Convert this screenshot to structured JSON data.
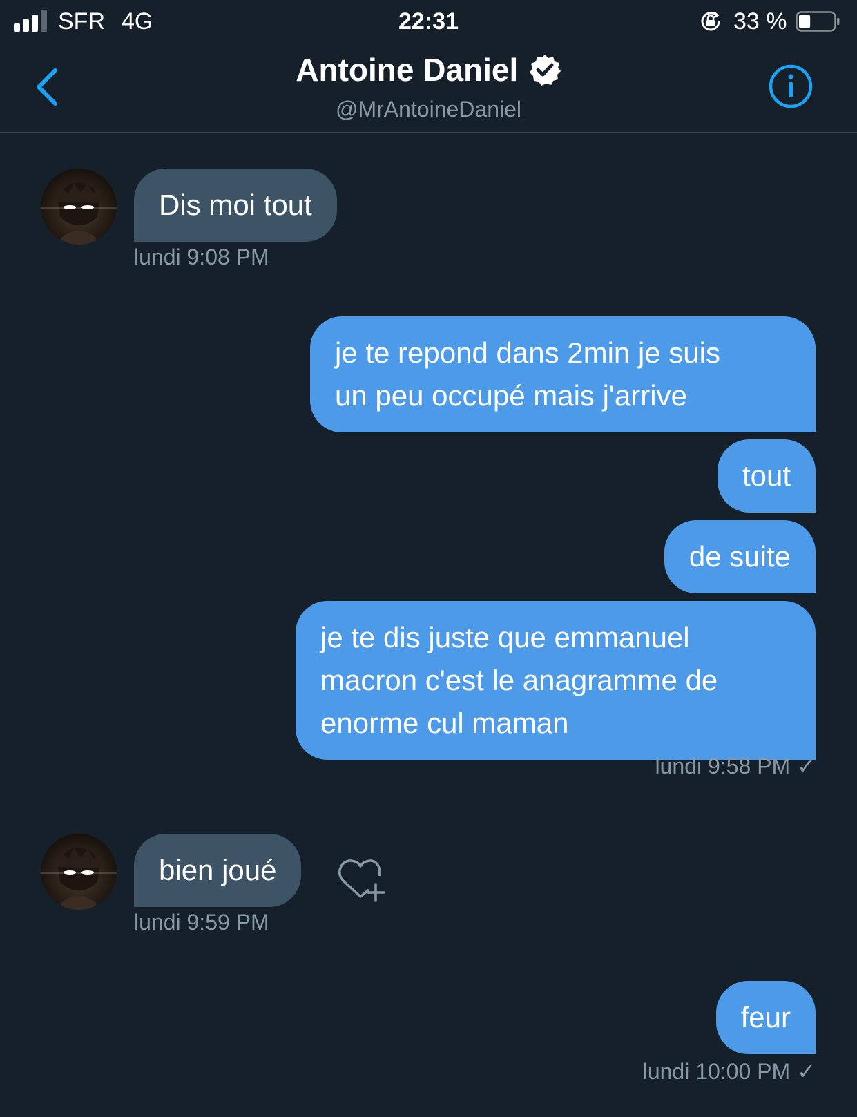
{
  "status_bar": {
    "carrier": "SFR",
    "network": "4G",
    "time": "22:31",
    "battery": "33 %",
    "battery_level": 0.33
  },
  "header": {
    "name": "Antoine Daniel",
    "handle": "@MrAntoineDaniel",
    "verified": true
  },
  "messages": [
    {
      "side": "in",
      "text": "Dis moi tout"
    },
    {
      "side": "in",
      "time": "lundi 9:08 PM"
    },
    {
      "side": "out",
      "lines": [
        "je te repond dans 2min je suis",
        "un peu occupé mais j'arrive"
      ]
    },
    {
      "side": "out",
      "text": "tout"
    },
    {
      "side": "out",
      "text": "de suite"
    },
    {
      "side": "out",
      "lines": [
        "je te dis juste que emmanuel",
        "macron c'est le anagramme de",
        "enorme cul maman"
      ]
    },
    {
      "side": "out",
      "time": "lundi 9:58 PM",
      "check": "✓"
    },
    {
      "side": "in",
      "text": "bien joué"
    },
    {
      "side": "in",
      "time": "lundi 9:59 PM"
    },
    {
      "side": "out",
      "text": "feur"
    },
    {
      "side": "out",
      "time": "lundi 10:00 PM",
      "check": "✓"
    }
  ],
  "colors": {
    "background": "#15202b",
    "incoming_bubble": "#3d5466",
    "outgoing_bubble": "#4d9ae8",
    "accent": "#1da1f2",
    "muted_text": "#8899a6"
  },
  "icons": [
    "back-chevron-icon",
    "verified-badge-icon",
    "info-icon",
    "heart-plus-icon",
    "rotation-lock-icon",
    "signal-icon",
    "battery-icon"
  ]
}
